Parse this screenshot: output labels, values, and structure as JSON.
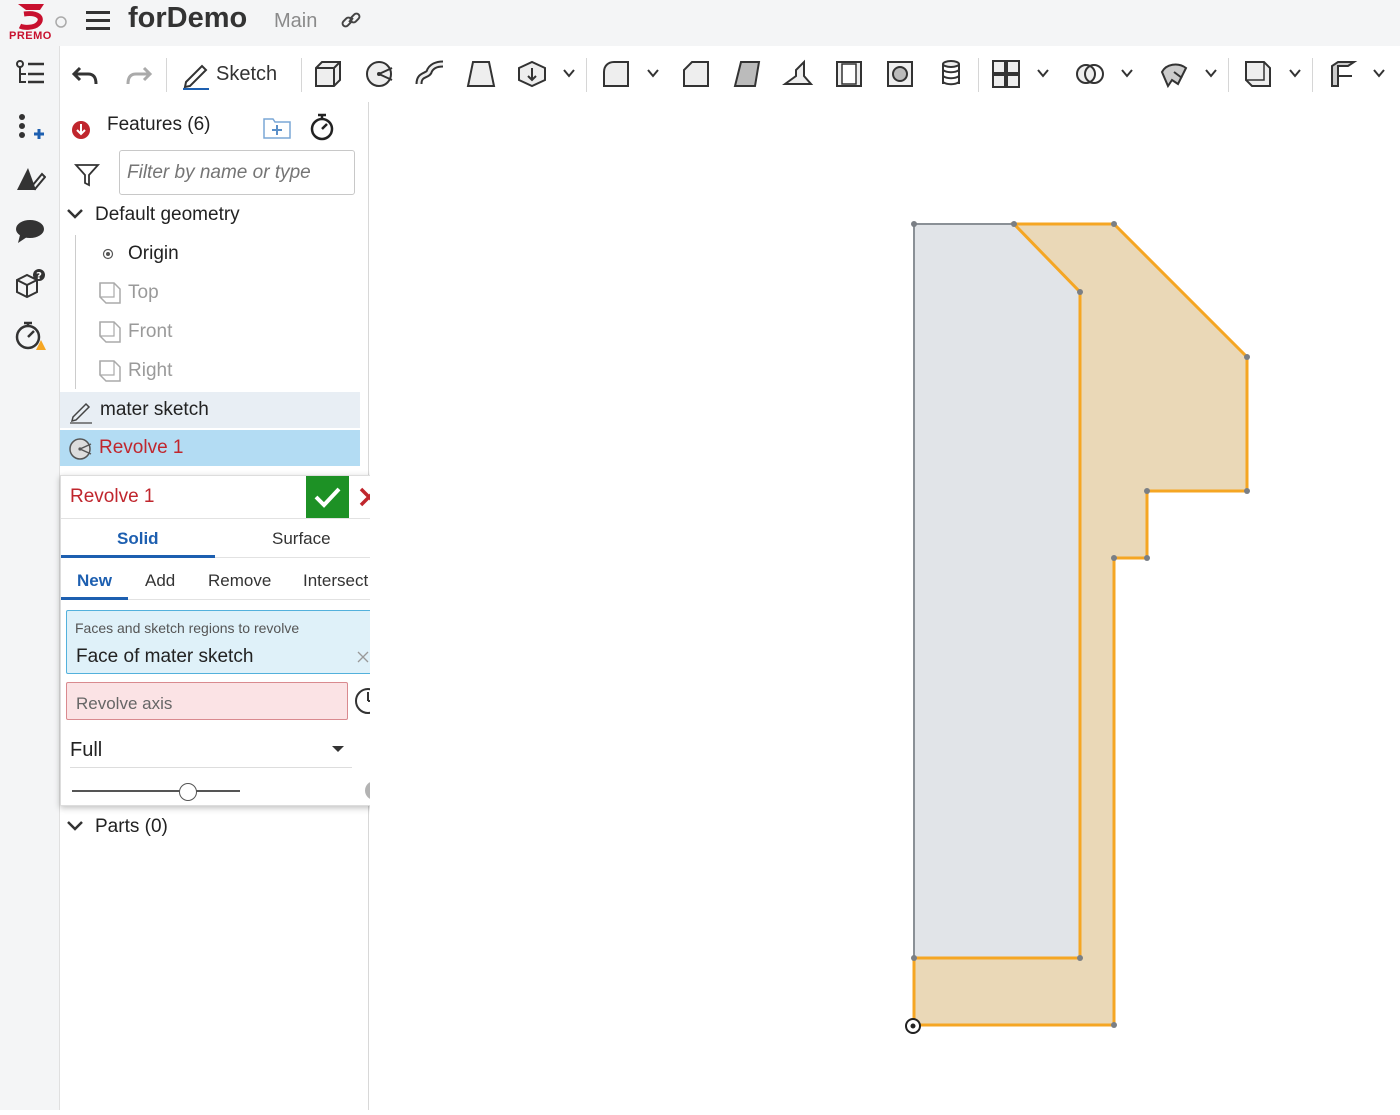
{
  "app": {
    "logo_text": "PREMO",
    "doc_title": "forDemo",
    "branch": "Main"
  },
  "left_rail": {
    "items": [
      {
        "icon": "feature-list-icon"
      },
      {
        "icon": "insert-variable-icon"
      },
      {
        "icon": "appearance-icon"
      },
      {
        "icon": "comments-icon"
      },
      {
        "icon": "parts-help-icon"
      },
      {
        "icon": "performance-warning-icon"
      }
    ]
  },
  "toolbar": {
    "undo": "undo-icon",
    "redo": "redo-icon",
    "sketch_label": "Sketch",
    "tools": [
      "extrude-icon",
      "revolve-icon",
      "sweep-icon",
      "loft-icon",
      "thicken-icon",
      "fillet-icon",
      "chamfer-icon",
      "draft-icon",
      "rib-icon",
      "shell-icon",
      "hole-icon",
      "thread-icon",
      "pattern-icon",
      "boolean-icon",
      "transform-icon",
      "plane-icon",
      "sheet-metal-icon"
    ]
  },
  "feature_panel": {
    "title": "Features (6)",
    "filter_placeholder": "Filter by name or type",
    "default_geometry_label": "Default geometry",
    "origin_label": "Origin",
    "planes": [
      "Top",
      "Front",
      "Right"
    ],
    "sketch_label": "mater sketch",
    "revolve_label": "Revolve 1",
    "parts_label": "Parts (0)"
  },
  "revolve_dialog": {
    "title": "Revolve 1",
    "body_tabs": [
      "Solid",
      "Surface"
    ],
    "op_tabs": [
      "New",
      "Add",
      "Remove",
      "Intersect"
    ],
    "faces_label": "Faces and sketch regions to revolve",
    "faces_value": "Face of mater sketch",
    "axis_placeholder": "Revolve axis",
    "revolve_type": "Full",
    "help": "?"
  },
  "colors": {
    "accent_blue": "#1d5fb0",
    "error_red": "#c0262d",
    "ok_green": "#1d9125",
    "region_fill": "#e8d6b4",
    "region_outline": "#f5a623",
    "grey_region": "#e1e4e8"
  }
}
